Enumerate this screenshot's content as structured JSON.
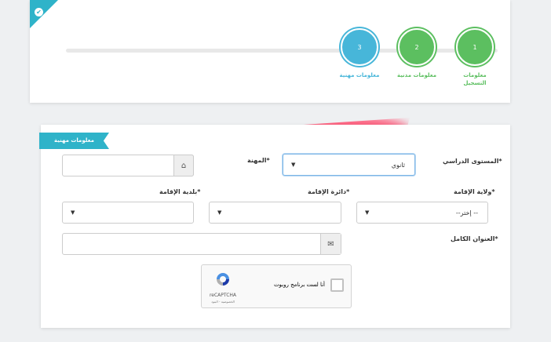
{
  "progress": {
    "steps": [
      {
        "number": "3",
        "label": "معلومات مهنية",
        "color": "#47b6d9"
      },
      {
        "number": "2",
        "label": "معلومات مدنية",
        "color": "#5cbf60"
      },
      {
        "number": "1",
        "label": "معلومات التسجيل",
        "color": "#5cbf60"
      }
    ],
    "check_glyph": "✔"
  },
  "form": {
    "section_title": "معلومات مهنية",
    "education_label": "المستوى الدراسي*",
    "education_value": "ثانوي",
    "profession_label": "المهنة*",
    "profession_value": "",
    "wilaya_label": "ولاية الإقامة*",
    "wilaya_value": "--إختر --",
    "daira_label": "دائرة الإقامة*",
    "daira_value": "",
    "commune_label": "بلدية الإقامة*",
    "commune_value": "",
    "address_label": "العنوان الكامل*",
    "address_value": "",
    "home_icon": "home-icon",
    "envelope_icon": "envelope-icon"
  },
  "captcha": {
    "checkbox_label": "أنا لست برنامج روبوت",
    "brand": "reCAPTCHA",
    "terms": "الخصوصية - البنود"
  }
}
